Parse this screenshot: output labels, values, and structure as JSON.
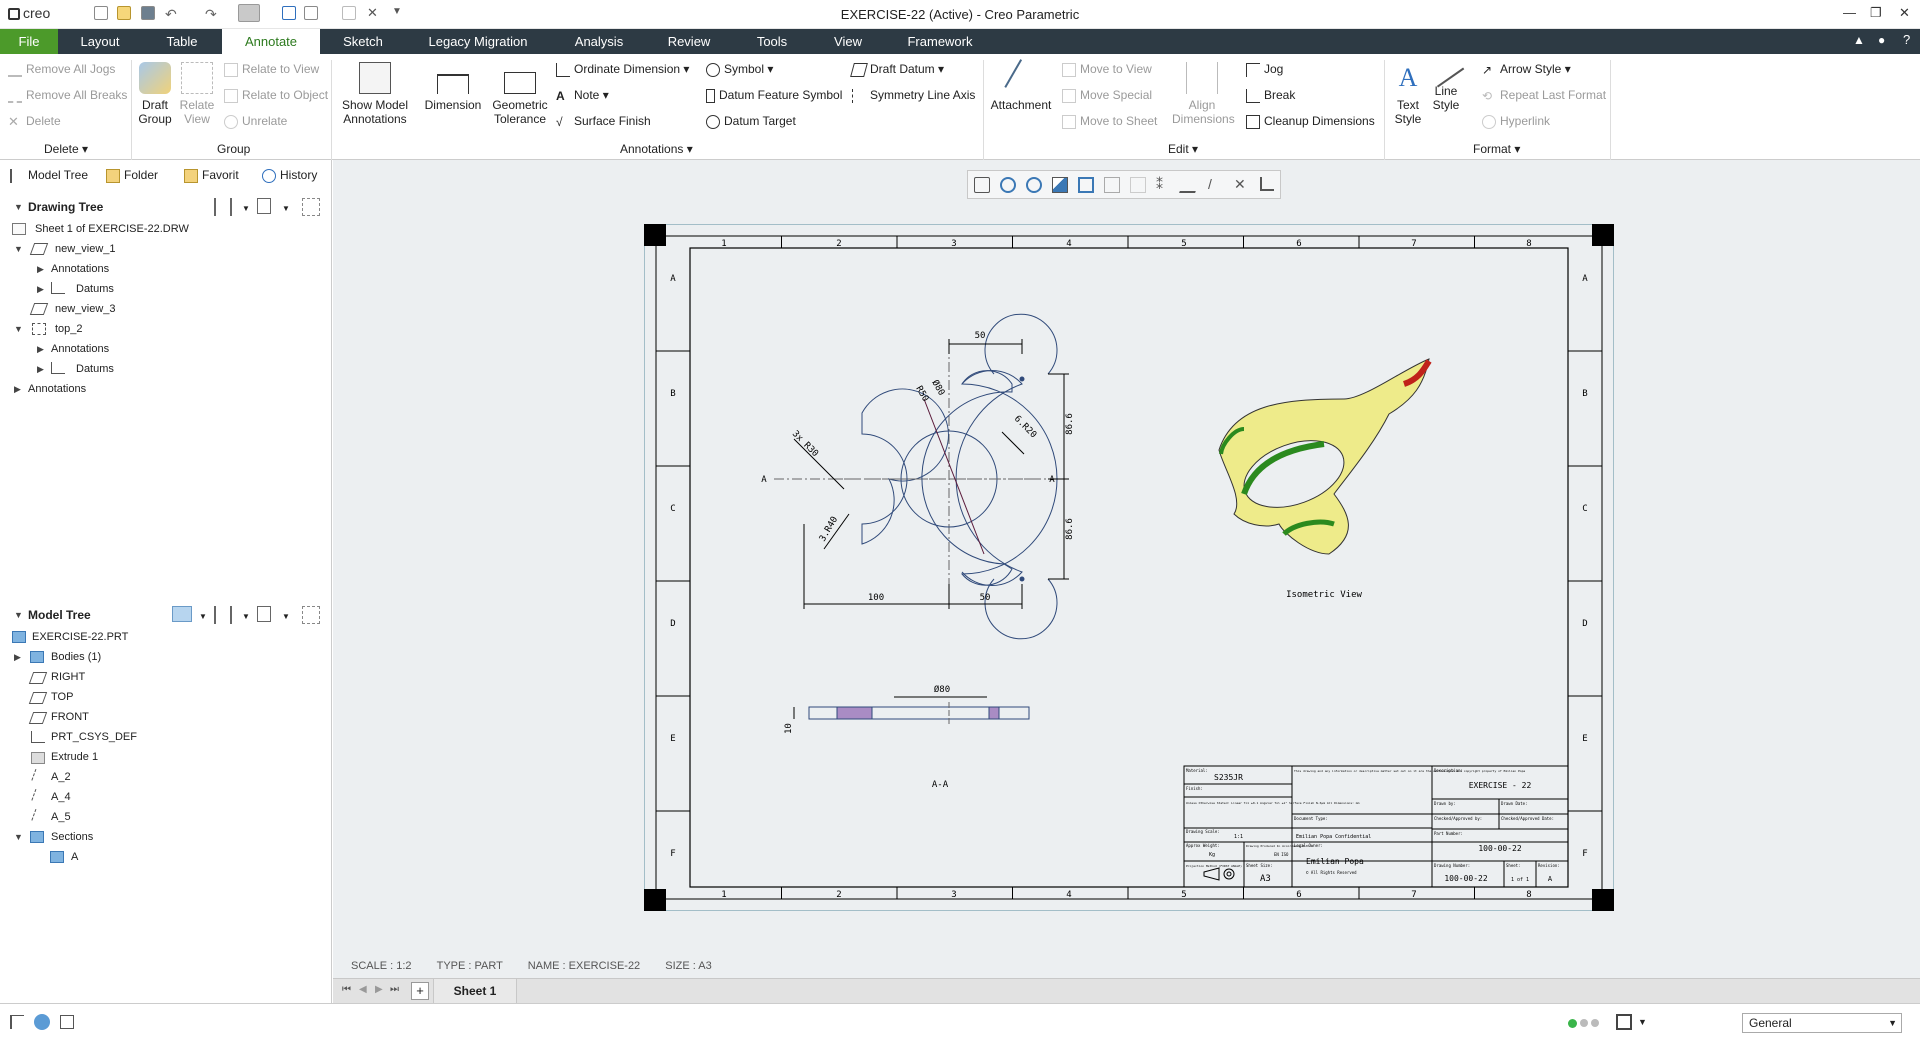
{
  "window": {
    "title": "EXERCISE-22 (Active) - Creo Parametric",
    "logo": "creo"
  },
  "menu": {
    "tabs": [
      "File",
      "Layout",
      "Table",
      "Annotate",
      "Sketch",
      "Legacy Migration",
      "Analysis",
      "Review",
      "Tools",
      "View",
      "Framework"
    ],
    "active": "Annotate"
  },
  "ribbon": {
    "delete_group": {
      "items": [
        "Remove All Jogs",
        "Remove All Breaks",
        "Delete"
      ],
      "label": "Delete"
    },
    "group_group": {
      "draft_group": "Draft Group",
      "relate_view": "Relate View",
      "relate_to_view": "Relate to View",
      "relate_to_object": "Relate to Object",
      "unrelate": "Unrelate",
      "label": "Group"
    },
    "annotations_group": {
      "show_model": "Show Model Annotations",
      "dimension": "Dimension",
      "geometric_tolerance": "Geometric Tolerance",
      "ordinate": "Ordinate Dimension",
      "note": "Note",
      "surface_finish": "Surface Finish",
      "symbol": "Symbol",
      "datum_feature": "Datum Feature Symbol",
      "datum_target": "Datum Target",
      "draft_datum": "Draft Datum",
      "symmetry": "Symmetry Line Axis",
      "label": "Annotations"
    },
    "edit_group": {
      "attachment": "Attachment",
      "move_to_view": "Move to View",
      "move_special": "Move Special",
      "move_to_sheet": "Move to Sheet",
      "align_dimensions": "Align Dimensions",
      "jog": "Jog",
      "break": "Break",
      "cleanup": "Cleanup Dimensions",
      "label": "Edit"
    },
    "format_group": {
      "text_style": "Text Style",
      "line_style": "Line Style",
      "arrow_style": "Arrow Style",
      "repeat_last": "Repeat Last Format",
      "hyperlink": "Hyperlink",
      "label": "Format"
    }
  },
  "panel_tabs": [
    "Model Tree",
    "Folder",
    "Favorit",
    "History"
  ],
  "drawing_tree": {
    "title": "Drawing Tree",
    "items": [
      "Sheet 1 of EXERCISE-22.DRW",
      "new_view_1",
      "Annotations",
      "Datums",
      "new_view_3",
      "top_2",
      "Annotations",
      "Datums",
      "Annotations"
    ]
  },
  "model_tree": {
    "title": "Model Tree",
    "items": [
      "EXERCISE-22.PRT",
      "Bodies (1)",
      "RIGHT",
      "TOP",
      "FRONT",
      "PRT_CSYS_DEF",
      "Extrude 1",
      "A_2",
      "A_4",
      "A_5",
      "Sections",
      "A"
    ]
  },
  "drawing": {
    "col_labels": [
      "1",
      "2",
      "3",
      "4",
      "5",
      "6",
      "7",
      "8"
    ],
    "row_labels": [
      "A",
      "B",
      "C",
      "D",
      "E",
      "F"
    ],
    "dims": {
      "d50_top": "50",
      "r50": "R50",
      "d80": "Ø80",
      "r20": "6.R20",
      "d866a": "86.6",
      "d866b": "86.6",
      "r30": "3x R30",
      "r40": "3.R40",
      "d100": "100",
      "d50_bot": "50",
      "section_mark": "A",
      "dia80": "Ø80",
      "t10": "10"
    },
    "section_label": "A-A",
    "iso_label": "Isometric View",
    "title_block": {
      "material_label": "Material:",
      "material": "S235JR",
      "finish_label": "Finish:",
      "tolerance_note": "Unless Otherwise Stated: Linear Tol ±0.1 Angular Tol ±1° Surface Finish N.6µm All Dimensions: mm",
      "scale_label": "Drawing Scale:",
      "scale": "1:1",
      "weight_label": "Approx Weight:",
      "weight": "Kg",
      "produced_label": "Drawing Produced In Accordance With:",
      "produced": "EN ISO",
      "projection_label": "Projection Method (FIRST ANGLE)",
      "sheet_size_label": "Sheet Size:",
      "sheet_size": "A3",
      "confidential_text": "This drawing and any information or descriptive matter set out on it are the confidential and copyright property of Emilian Popa",
      "document_type_label": "Document Type:",
      "confidential": "Emilian Popa Confidential",
      "legal_owner_label": "Legal Owner:",
      "owner": "Emilian Popa",
      "owner_note": "© All Rights Reserved",
      "description_label": "Description:",
      "description": "EXERCISE - 22",
      "drawn_by_label": "Drawn by:",
      "drawn_date_label": "Drawn Date:",
      "checked_label": "Checked/Approved by:",
      "checked_date_label": "Checked/Approved Date:",
      "part_number_label": "Part Number:",
      "part_number": "100-00-22",
      "drawing_number_label": "Drawing Number:",
      "drawing_number": "100-00-22",
      "sheet_label": "Sheet:",
      "sheet": "1 of 1",
      "revision_label": "Revision:",
      "revision": "A"
    }
  },
  "status": {
    "scale": "SCALE : 1:2",
    "type": "TYPE : PART",
    "name": "NAME : EXERCISE-22",
    "size": "SIZE : A3"
  },
  "sheet_tab": "Sheet 1",
  "filter": {
    "value": "General"
  }
}
